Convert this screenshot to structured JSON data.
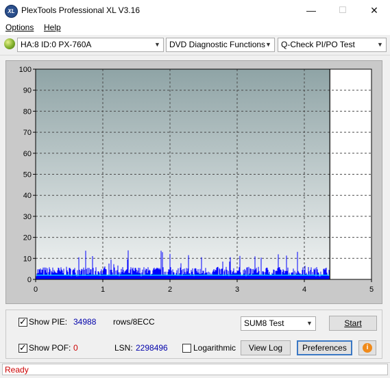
{
  "window": {
    "title": "PlexTools Professional XL V3.16",
    "app_icon_text": "XL",
    "minimize_glyph": "—",
    "maximize_glyph": "☐",
    "close_glyph": "✕"
  },
  "menu": {
    "options": "Options",
    "help": "Help"
  },
  "toolbar": {
    "drive": "HA:8 ID:0  PX-760A",
    "function": "DVD Diagnostic Functions",
    "test": "Q-Check PI/PO Test"
  },
  "chart_data": {
    "type": "bar",
    "x_ticks": [
      "0",
      "1",
      "2",
      "3",
      "4",
      "5"
    ],
    "y_ticks": [
      "0",
      "10",
      "20",
      "30",
      "40",
      "50",
      "60",
      "70",
      "80",
      "90",
      "100"
    ],
    "xlim": [
      0,
      5
    ],
    "ylim": [
      0,
      100
    ],
    "grid": true,
    "scan_end_x": 4.38,
    "series": [
      {
        "color": "#0000ff",
        "type": "pie-spikes",
        "typical_max": 6,
        "peak": 14
      },
      {
        "color": "#00c8ff",
        "type": "pie-sum-line",
        "level": 2
      }
    ]
  },
  "controls": {
    "show_pie_label": "Show PIE:",
    "show_pie_value": "34988",
    "rows_label": "rows/8ECC",
    "show_pof_label": "Show POF:",
    "show_pof_value": "0",
    "lsn_label": "LSN:",
    "lsn_value": "2298496",
    "logarithmic_label": "Logarithmic",
    "sum_test_selected": "SUM8 Test",
    "start_label": "Start",
    "view_log_label": "View Log",
    "preferences_label": "Preferences",
    "info_glyph": "i"
  },
  "status": {
    "text": "Ready"
  }
}
